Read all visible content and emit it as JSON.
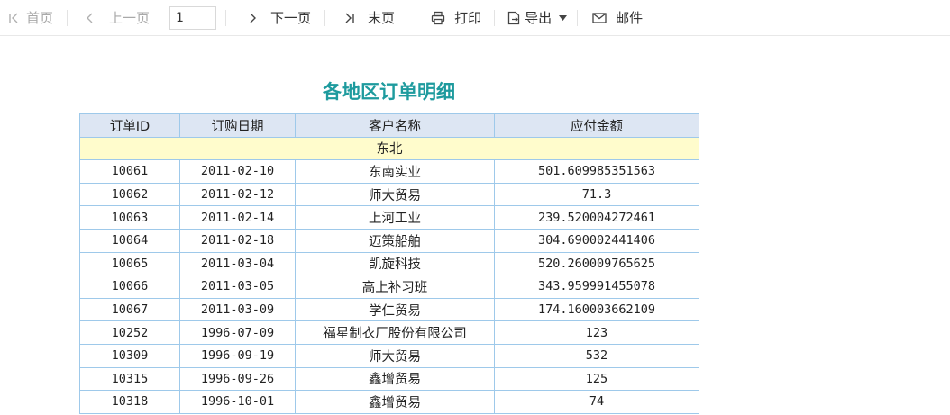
{
  "toolbar": {
    "first": "首页",
    "prev": "上一页",
    "page_value": "1",
    "next": "下一页",
    "last": "末页",
    "print": "打印",
    "export": "导出",
    "mail": "邮件"
  },
  "report": {
    "title": "各地区订单明细",
    "headers": [
      "订单ID",
      "订购日期",
      "客户名称",
      "应付金额"
    ],
    "group": "东北",
    "rows": [
      [
        "10061",
        "2011-02-10",
        "东南实业",
        "501.609985351563"
      ],
      [
        "10062",
        "2011-02-12",
        "师大贸易",
        "71.3"
      ],
      [
        "10063",
        "2011-02-14",
        "上河工业",
        "239.520004272461"
      ],
      [
        "10064",
        "2011-02-18",
        "迈策船舶",
        "304.690002441406"
      ],
      [
        "10065",
        "2011-03-04",
        "凯旋科技",
        "520.260009765625"
      ],
      [
        "10066",
        "2011-03-05",
        "高上补习班",
        "343.959991455078"
      ],
      [
        "10067",
        "2011-03-09",
        "学仁贸易",
        "174.160003662109"
      ],
      [
        "10252",
        "1996-07-09",
        "福星制衣厂股份有限公司",
        "123"
      ],
      [
        "10309",
        "1996-09-19",
        "师大贸易",
        "532"
      ],
      [
        "10315",
        "1996-09-26",
        "鑫增贸易",
        "125"
      ],
      [
        "10318",
        "1996-10-01",
        "鑫增贸易",
        "74"
      ]
    ]
  }
}
